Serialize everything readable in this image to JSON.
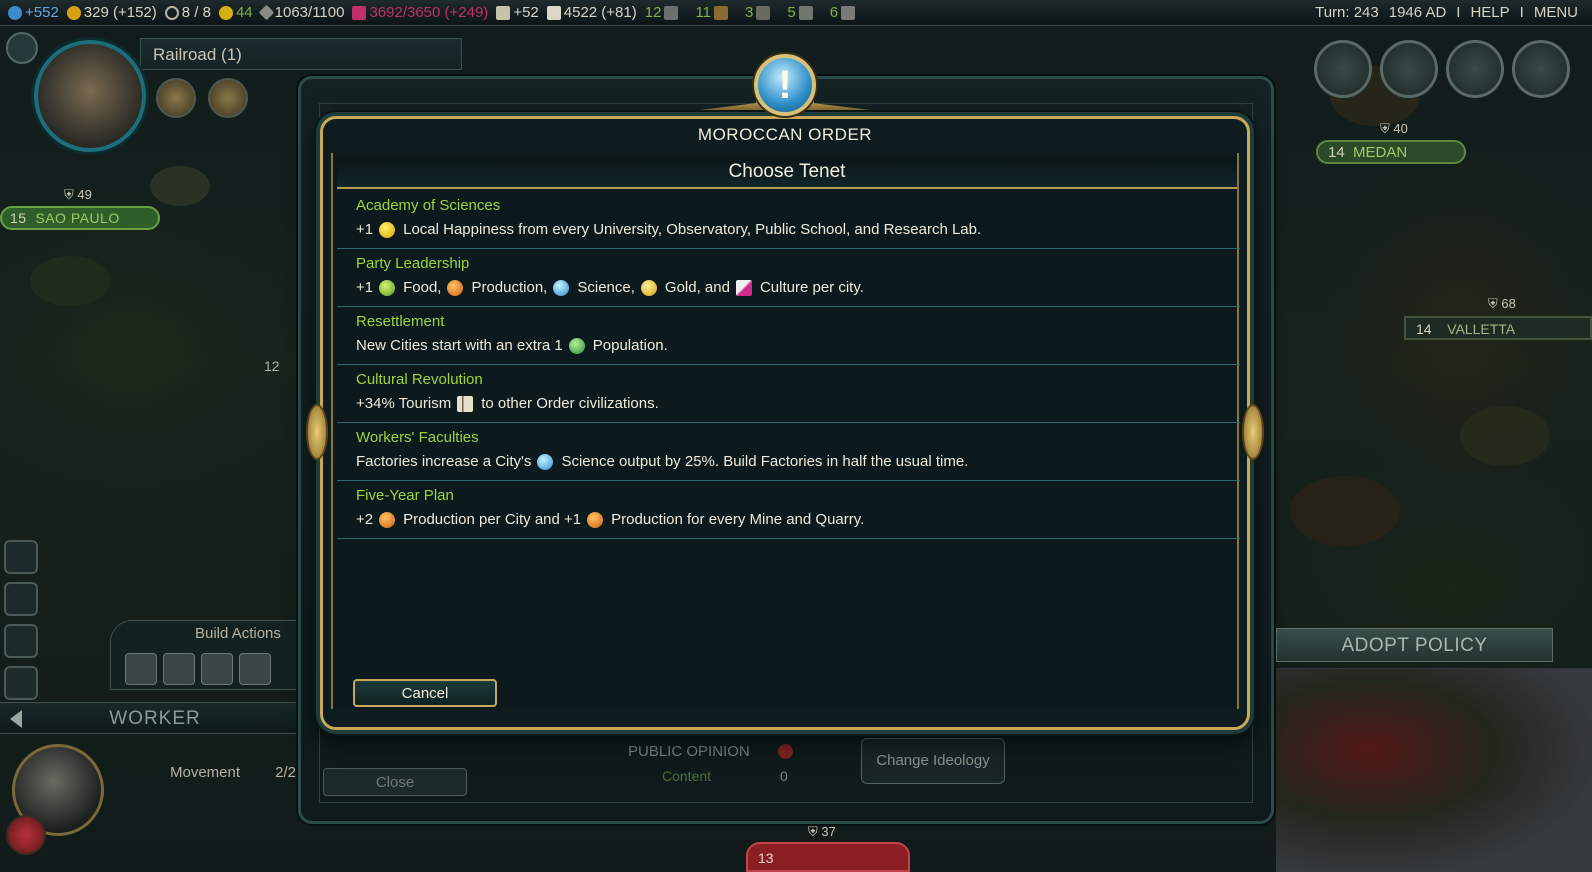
{
  "topbar": {
    "science": "+552",
    "gold": "329 (+152)",
    "trade_routes": "8 / 8",
    "happiness": "44",
    "strategic": "1063/1100",
    "culture": "3692/3650 (+249)",
    "tourism": "+52",
    "faith": "4522 (+81)",
    "great_people": [
      {
        "count": "12",
        "icon": "great-writer-icon"
      },
      {
        "count": "11",
        "icon": "great-artist-icon"
      },
      {
        "count": "3",
        "icon": "great-musician-icon"
      },
      {
        "count": "5",
        "icon": "great-scientist-icon"
      },
      {
        "count": "6",
        "icon": "great-engineer-icon"
      }
    ],
    "turn": "Turn: 243",
    "year": "1946 AD",
    "sep": "I",
    "help": "HELP",
    "menu": "MENU"
  },
  "city_panel": {
    "railroad": "Railroad (1)",
    "city_name": "SAO PAULO",
    "city_size": "15",
    "city_defense": "49"
  },
  "map_labels": {
    "medan_size": "14",
    "medan": "MEDAN",
    "medan_defense": "40",
    "valletta_size": "14",
    "valletta": "VALLETTA",
    "valletta_defense": "68",
    "misc_12": "12",
    "bottom_defense": "37",
    "bottom_city_size": "13"
  },
  "unit_panel": {
    "build_actions": "Build Actions",
    "unit_name": "WORKER",
    "movement_label": "Movement",
    "movement_value": "2/2"
  },
  "policies_screen": {
    "adopt_policy": "ADOPT POLICY",
    "public_opinion_label": "PUBLIC OPINION",
    "public_opinion_value": "Content",
    "unhappiness_value": "0",
    "change_ideology": "Change Ideology",
    "close": "Close"
  },
  "popup": {
    "badge": "!",
    "title": "MOROCCAN ORDER",
    "subtitle": "Choose Tenet",
    "cancel": "Cancel",
    "tenets": [
      {
        "name": "Academy of Sciences",
        "parts": [
          "+1",
          "Local Happiness from every University, Observatory, Public School, and Research Lab."
        ],
        "icon": "happiness-icon"
      },
      {
        "name": "Party Leadership",
        "parts": [
          "+1",
          "Food,",
          "Production,",
          "Science,",
          "Gold, and",
          "Culture per city."
        ],
        "icons": [
          "food-icon",
          "production-icon",
          "science-icon",
          "gold-icon",
          "culture-icon"
        ]
      },
      {
        "name": "Resettlement",
        "parts": [
          "New Cities start with an extra 1",
          "Population."
        ],
        "icon": "population-icon"
      },
      {
        "name": "Cultural Revolution",
        "parts": [
          "+34% Tourism",
          "to other Order civilizations."
        ],
        "icon": "tourism-icon"
      },
      {
        "name": "Workers' Faculties",
        "parts": [
          "Factories increase a City's",
          "Science output by 25%. Build Factories in half the usual time."
        ],
        "icon": "science-icon"
      },
      {
        "name": "Five-Year Plan",
        "parts": [
          "+2",
          "Production per City and +1",
          "Production for every Mine and Quarry."
        ],
        "icons": [
          "production-icon",
          "production-icon"
        ]
      }
    ]
  }
}
